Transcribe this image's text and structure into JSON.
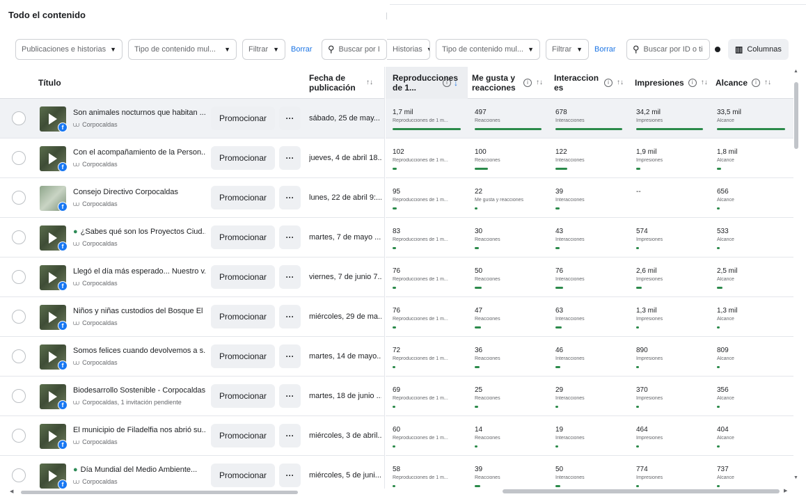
{
  "page": {
    "title": "Todo el contenido"
  },
  "toolbar": {
    "left": [
      {
        "label": "Publicaciones e historias",
        "type": "dropdown"
      },
      {
        "label": "Tipo de contenido mul...",
        "type": "dropdown"
      },
      {
        "label": "Filtrar",
        "type": "dropdown"
      }
    ],
    "left_clear": "Borrar",
    "search_left_placeholder": "Buscar por I",
    "right": [
      {
        "label": "Historias",
        "type": "dropdown"
      },
      {
        "label": "Tipo de contenido mul...",
        "type": "dropdown"
      },
      {
        "label": "Filtrar",
        "type": "dropdown"
      }
    ],
    "right_clear": "Borrar",
    "search_right_placeholder": "Buscar por ID o ti",
    "columns_label": "Columnas"
  },
  "table": {
    "headers": {
      "title": "Título",
      "date": "Fecha de publicación",
      "plays": "Reproducciones de 1...",
      "likes": "Me gusta y reacciones",
      "interactions": "Interacciones",
      "impressions": "Impresiones",
      "reach": "Alcance"
    },
    "promote_label": "Promocionar",
    "more_label": "···",
    "rows": [
      {
        "title": "Son animales nocturnos que habitan ...",
        "page": "Corpocaldas",
        "date": "sábado, 25 de may...",
        "plays": "1,7 mil",
        "plays_label": "Reproducciones de 1 m...",
        "likes": "497",
        "likes_label": "Reacciones",
        "interactions": "678",
        "interactions_label": "Interacciones",
        "impressions": "34,2 mil",
        "impressions_label": "Impresiones",
        "reach": "33,5 mil",
        "reach_label": "Alcance",
        "bars": [
          1.0,
          1.0,
          1.0,
          1.0,
          1.0
        ],
        "selected": true,
        "thumb": "video",
        "leaf": false
      },
      {
        "title": "Con el acompañamiento de la Person...",
        "page": "Corpocaldas",
        "date": "jueves, 4 de abril 18...",
        "plays": "102",
        "plays_label": "Reproducciones de 1 m...",
        "likes": "100",
        "likes_label": "Reacciones",
        "interactions": "122",
        "interactions_label": "Interacciones",
        "impressions": "1,9 mil",
        "impressions_label": "Impresiones",
        "reach": "1,8 mil",
        "reach_label": "Alcance",
        "bars": [
          0.06,
          0.2,
          0.18,
          0.06,
          0.06
        ],
        "selected": false,
        "thumb": "video",
        "leaf": false
      },
      {
        "title": "Consejo Directivo Corpocaldas",
        "page": "Corpocaldas",
        "date": "lunes, 22 de abril 9:...",
        "plays": "95",
        "plays_label": "Reproducciones de 1 m...",
        "likes": "22",
        "likes_label": "Me gusta y reacciones",
        "interactions": "39",
        "interactions_label": "Interacciones",
        "impressions": "--",
        "impressions_label": "",
        "reach": "656",
        "reach_label": "Alcance",
        "bars": [
          0.06,
          0.04,
          0.06,
          0,
          0.02
        ],
        "selected": false,
        "thumb": "doc",
        "leaf": false
      },
      {
        "title": "¿Sabes qué son los Proyectos Ciud...",
        "page": "Corpocaldas",
        "date": "martes, 7 de mayo ...",
        "plays": "83",
        "plays_label": "Reproducciones de 1 m...",
        "likes": "30",
        "likes_label": "Reacciones",
        "interactions": "43",
        "interactions_label": "Interacciones",
        "impressions": "574",
        "impressions_label": "Impresiones",
        "reach": "533",
        "reach_label": "Alcance",
        "bars": [
          0.05,
          0.06,
          0.06,
          0.02,
          0.02
        ],
        "selected": false,
        "thumb": "video",
        "leaf": true
      },
      {
        "title": "Llegó el día más esperado... Nuestro v...",
        "page": "Corpocaldas",
        "date": "viernes, 7 de junio 7...",
        "plays": "76",
        "plays_label": "Reproducciones de 1 m...",
        "likes": "50",
        "likes_label": "Reacciones",
        "interactions": "76",
        "interactions_label": "Interacciones",
        "impressions": "2,6 mil",
        "impressions_label": "Impresiones",
        "reach": "2,5 mil",
        "reach_label": "Alcance",
        "bars": [
          0.05,
          0.1,
          0.11,
          0.08,
          0.08
        ],
        "selected": false,
        "thumb": "video",
        "leaf": false
      },
      {
        "title": "Niños y niñas custodios del Bosque El ...",
        "page": "Corpocaldas",
        "date": "miércoles, 29 de ma...",
        "plays": "76",
        "plays_label": "Reproducciones de 1 m...",
        "likes": "47",
        "likes_label": "Reacciones",
        "interactions": "63",
        "interactions_label": "Interacciones",
        "impressions": "1,3 mil",
        "impressions_label": "Impresiones",
        "reach": "1,3 mil",
        "reach_label": "Alcance",
        "bars": [
          0.05,
          0.09,
          0.09,
          0.04,
          0.04
        ],
        "selected": false,
        "thumb": "video",
        "leaf": false
      },
      {
        "title": "Somos felices cuando devolvemos a s...",
        "page": "Corpocaldas",
        "date": "martes, 14 de mayo...",
        "plays": "72",
        "plays_label": "Reproducciones de 1 m...",
        "likes": "36",
        "likes_label": "Reacciones",
        "interactions": "46",
        "interactions_label": "Interacciones",
        "impressions": "890",
        "impressions_label": "Impresiones",
        "reach": "809",
        "reach_label": "Alcance",
        "bars": [
          0.04,
          0.07,
          0.07,
          0.03,
          0.03
        ],
        "selected": false,
        "thumb": "video",
        "leaf": false
      },
      {
        "title": "Biodesarrollo Sostenible - Corpocaldas",
        "page": "Corpocaldas, 1 invitación pendiente",
        "date": "martes, 18 de junio ...",
        "plays": "69",
        "plays_label": "Reproducciones de 1 m...",
        "likes": "25",
        "likes_label": "Reacciones",
        "interactions": "29",
        "interactions_label": "Interacciones",
        "impressions": "370",
        "impressions_label": "Impresiones",
        "reach": "356",
        "reach_label": "Alcance",
        "bars": [
          0.04,
          0.05,
          0.04,
          0.01,
          0.01
        ],
        "selected": false,
        "thumb": "video",
        "leaf": false
      },
      {
        "title": "El municipio de Filadelfia nos abrió su...",
        "page": "Corpocaldas",
        "date": "miércoles, 3 de abril...",
        "plays": "60",
        "plays_label": "Reproducciones de 1 m...",
        "likes": "14",
        "likes_label": "Reacciones",
        "interactions": "19",
        "interactions_label": "Interacciones",
        "impressions": "464",
        "impressions_label": "Impresiones",
        "reach": "404",
        "reach_label": "Alcance",
        "bars": [
          0.04,
          0.03,
          0.03,
          0.01,
          0.01
        ],
        "selected": false,
        "thumb": "video",
        "leaf": false
      },
      {
        "title": "Día Mundial del Medio Ambiente...",
        "page": "Corpocaldas",
        "date": "miércoles, 5 de juni...",
        "plays": "58",
        "plays_label": "Reproducciones de 1 m...",
        "likes": "39",
        "likes_label": "Reacciones",
        "interactions": "50",
        "interactions_label": "Interacciones",
        "impressions": "774",
        "impressions_label": "Impresiones",
        "reach": "737",
        "reach_label": "Alcance",
        "bars": [
          0.03,
          0.08,
          0.07,
          0.02,
          0.02
        ],
        "selected": false,
        "thumb": "video",
        "leaf": true
      }
    ]
  },
  "colors": {
    "accent": "#1b74e4",
    "bar": "#2b8a4a",
    "facebook": "#1877f2"
  }
}
